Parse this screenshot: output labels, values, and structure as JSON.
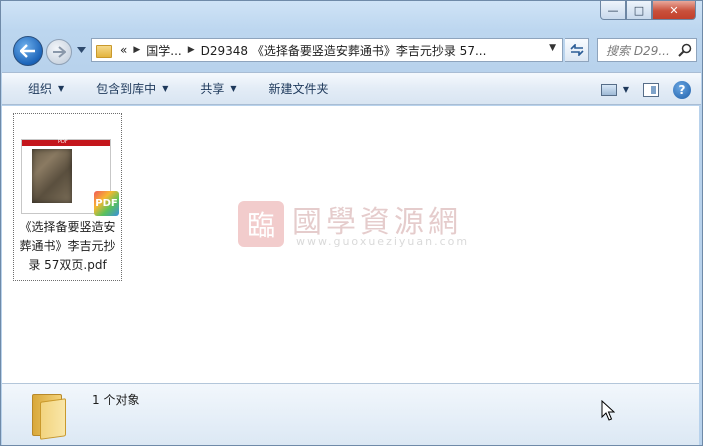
{
  "window": {
    "caption_buttons": {
      "minimize": "—",
      "maximize": "□",
      "close": "✕"
    }
  },
  "navigation": {
    "back_icon": "back-arrow-icon",
    "forward_icon": "forward-arrow-icon"
  },
  "address_bar": {
    "overflow": "«",
    "crumbs": [
      "国学...",
      "D29348 《选择备要竖造安葬通书》李吉元抄录 57..."
    ]
  },
  "search": {
    "placeholder": "搜索 D29..."
  },
  "command_bar": {
    "organize": "组织",
    "include_in_library": "包含到库中",
    "share": "共享",
    "new_folder": "新建文件夹"
  },
  "files": [
    {
      "name": "《选择备要竖造安葬通书》李吉元抄录 57双页.pdf",
      "name_lines": [
        "《选择备要竖造安",
        "葬通书》李吉元抄",
        "录 57双页.pdf"
      ],
      "thumb_header": "PDF",
      "badge": "PDF"
    }
  ],
  "watermark": {
    "logo": "臨",
    "title": "國學資源網",
    "url": "www.guoxueziyuan.com"
  },
  "details": {
    "object_count": "1 个对象"
  },
  "colors": {
    "accent": "#1c64b9",
    "pdf_red": "#c4161c"
  }
}
